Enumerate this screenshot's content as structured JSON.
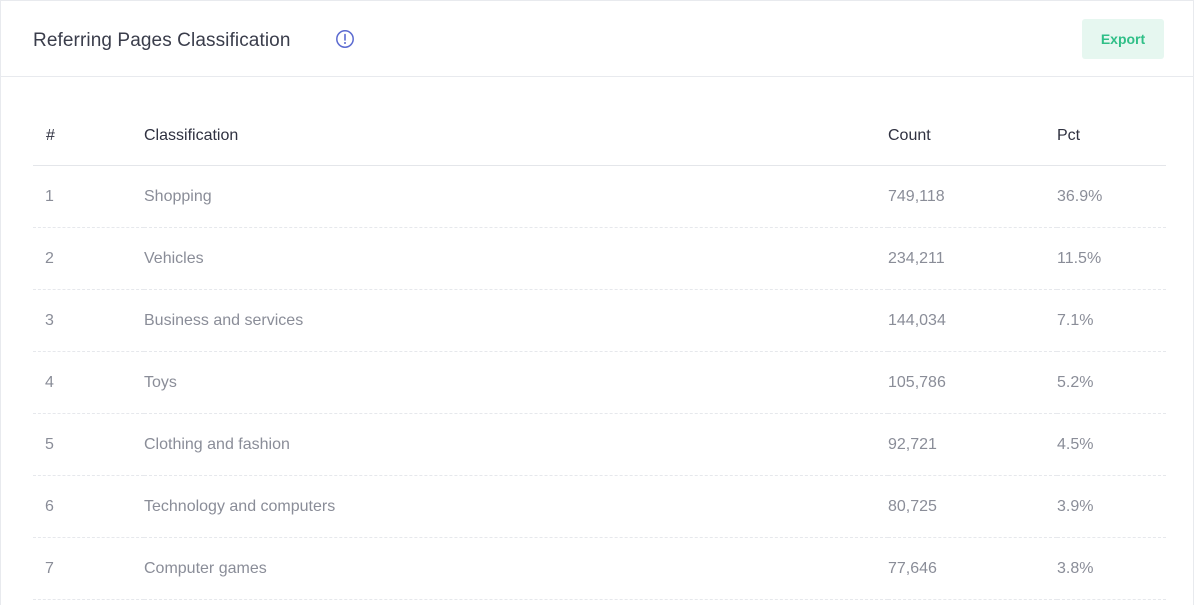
{
  "header": {
    "title": "Referring Pages Classification",
    "export_label": "Export"
  },
  "colors": {
    "accent": "#2fbf87",
    "accent_bg": "#e6f7f0",
    "info_icon": "#5b6ad0"
  },
  "table": {
    "columns": [
      "#",
      "Classification",
      "Count",
      "Pct"
    ],
    "rows": [
      {
        "num": "1",
        "classification": "Shopping",
        "count": "749,118",
        "pct": "36.9%"
      },
      {
        "num": "2",
        "classification": "Vehicles",
        "count": "234,211",
        "pct": "11.5%"
      },
      {
        "num": "3",
        "classification": "Business and services",
        "count": "144,034",
        "pct": "7.1%"
      },
      {
        "num": "4",
        "classification": "Toys",
        "count": "105,786",
        "pct": "5.2%"
      },
      {
        "num": "5",
        "classification": "Clothing and fashion",
        "count": "92,721",
        "pct": "4.5%"
      },
      {
        "num": "6",
        "classification": "Technology and computers",
        "count": "80,725",
        "pct": "3.9%"
      },
      {
        "num": "7",
        "classification": "Computer games",
        "count": "77,646",
        "pct": "3.8%"
      }
    ]
  }
}
